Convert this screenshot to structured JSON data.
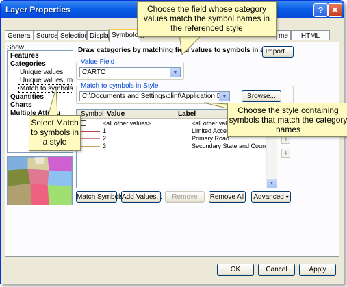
{
  "window": {
    "title": "Layer Properties"
  },
  "titlebar_buttons": {
    "help": "?",
    "close": "✕"
  },
  "tabs": [
    "General",
    "Source",
    "Selection",
    "Display",
    "Symbology",
    "me",
    "HTML Popup"
  ],
  "show": {
    "label": "Show:",
    "items": [
      "Features",
      "Categories",
      "Unique values",
      "Unique values, many",
      "Match to symbols in a style",
      "Quantities",
      "Charts",
      "Multiple Attribu"
    ]
  },
  "main": {
    "heading": "Draw categories by matching field values to symbols in a style.",
    "import_button": "Import...",
    "value_field": {
      "label": "Value Field",
      "value": "CARTO"
    },
    "match_style": {
      "label": "Match to symbols in Style",
      "value": "C:\\Documents and Settings\\clint\\Application Data\\ESRI\\",
      "browse_button": "Browse..."
    }
  },
  "table": {
    "columns": [
      "Symbol",
      "Value",
      "Label"
    ],
    "rows": [
      {
        "value": "<all other values>",
        "label": "<all other values>"
      },
      {
        "value": "1",
        "label": "Limited Access Highw"
      },
      {
        "value": "2",
        "label": "Primary Road"
      },
      {
        "value": "3",
        "label": "Secondary State and County ?"
      }
    ]
  },
  "table_buttons": [
    "Match Symbols",
    "Add Values...",
    "Remove",
    "Remove All",
    "Advanced"
  ],
  "footer_buttons": [
    "OK",
    "Cancel",
    "Apply"
  ],
  "callouts": {
    "top": "Choose the field whose category values match the symbol names in the referenced style",
    "right": "Choose the style containing symbols that match the category names",
    "left": "Select Match to symbols in a style"
  },
  "colors": {
    "callout_bg": "#fffbc0",
    "title_blue": "#0a5fe8",
    "tab_highlight": "#ffc83c"
  }
}
